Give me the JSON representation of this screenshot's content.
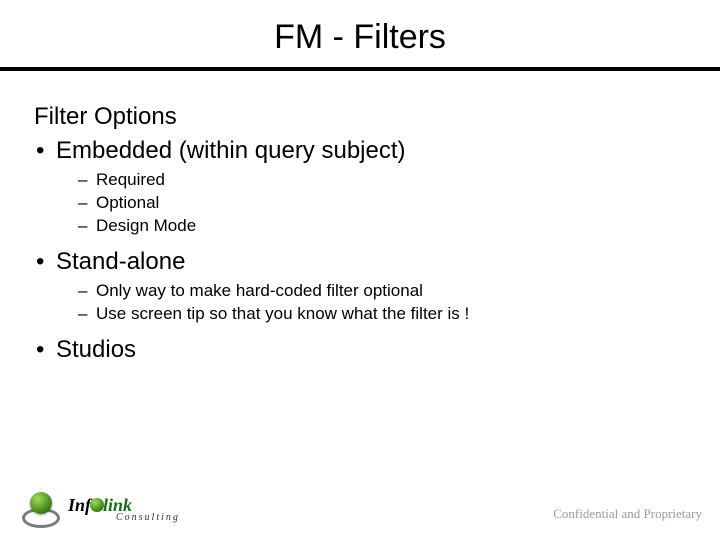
{
  "title": "FM - Filters",
  "heading": "Filter Options",
  "bullets": {
    "b0": {
      "label": "Embedded (within query subject)",
      "sub": {
        "s0": "Required",
        "s1": "Optional",
        "s2": "Design Mode"
      }
    },
    "b1": {
      "label": "Stand-alone",
      "sub": {
        "s0": "Only way to make hard-coded filter optional",
        "s1": "Use screen tip so that you know what the filter is !"
      }
    },
    "b2": {
      "label": "Studios"
    }
  },
  "logo": {
    "part1": "Inf",
    "part2": "link",
    "subtitle": "Consulting"
  },
  "footer": {
    "confidential": "Confidential and Proprietary"
  }
}
